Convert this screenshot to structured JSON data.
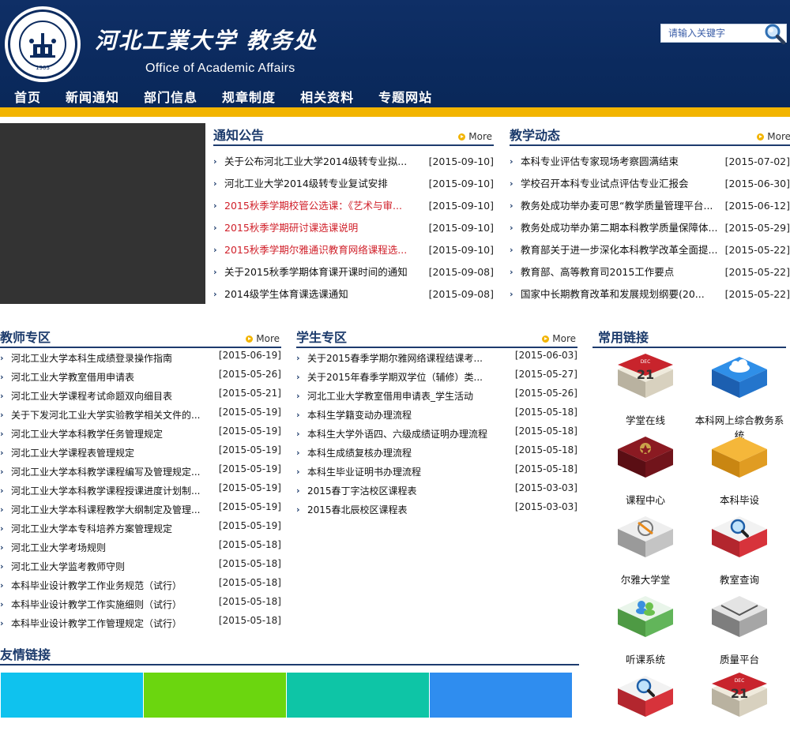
{
  "header": {
    "logo_year": "1903",
    "brand_cn": "河北工業大学 教务处",
    "brand_en": "Office of Academic Affairs",
    "search_placeholder": "请输入关键字"
  },
  "nav": [
    "首页",
    "新闻通知",
    "部门信息",
    "规章制度",
    "相关资料",
    "专题网站"
  ],
  "more_label": "More",
  "notices": {
    "title": "通知公告",
    "items": [
      {
        "text": "关于公布河北工业大学2014级转专业拟...",
        "date": "[2015-09-10]",
        "red": false
      },
      {
        "text": "河北工业大学2014级转专业复试安排",
        "date": "[2015-09-10]",
        "red": false
      },
      {
        "text": "2015秋季学期校管公选课：《艺术与审...",
        "date": "[2015-09-10]",
        "red": true
      },
      {
        "text": "2015秋季学期研讨课选课说明",
        "date": "[2015-09-10]",
        "red": true
      },
      {
        "text": "2015秋季学期尔雅通识教育网络课程选...",
        "date": "[2015-09-10]",
        "red": true
      },
      {
        "text": "关于2015秋季学期体育课开课时间的通知",
        "date": "[2015-09-08]",
        "red": false
      },
      {
        "text": "2014级学生体育课选课通知",
        "date": "[2015-09-08]",
        "red": false
      }
    ]
  },
  "teaching": {
    "title": "教学动态",
    "items": [
      {
        "text": "本科专业评估专家现场考察圆满结束",
        "date": "[2015-07-02]"
      },
      {
        "text": "学校召开本科专业试点评估专业汇报会",
        "date": "[2015-06-30]"
      },
      {
        "text": "教务处成功举办麦可思“教学质量管理平台...",
        "date": "[2015-06-12]"
      },
      {
        "text": "教务处成功举办第二期本科教学质量保障体...",
        "date": "[2015-05-29]"
      },
      {
        "text": "教育部关于进一步深化本科教学改革全面提...",
        "date": "[2015-05-22]"
      },
      {
        "text": "教育部、高等教育司2015工作要点",
        "date": "[2015-05-22]"
      },
      {
        "text": "国家中长期教育改革和发展规划纲要(20...",
        "date": "[2015-05-22]"
      }
    ]
  },
  "teachers": {
    "title": "教师专区",
    "items": [
      {
        "text": "河北工业大学本科生成绩登录操作指南",
        "date": "[2015-06-19]"
      },
      {
        "text": "河北工业大学教室借用申请表",
        "date": "[2015-05-26]"
      },
      {
        "text": "河北工业大学课程考试命题双向细目表",
        "date": "[2015-05-21]"
      },
      {
        "text": "关于下发河北工业大学实验教学相关文件的...",
        "date": "[2015-05-19]"
      },
      {
        "text": "河北工业大学本科教学任务管理规定",
        "date": "[2015-05-19]"
      },
      {
        "text": "河北工业大学课程表管理规定",
        "date": "[2015-05-19]"
      },
      {
        "text": "河北工业大学本科教学课程编写及管理规定...",
        "date": "[2015-05-19]"
      },
      {
        "text": "河北工业大学本科教学课程授课进度计划制...",
        "date": "[2015-05-19]"
      },
      {
        "text": "河北工业大学本科课程教学大纲制定及管理...",
        "date": "[2015-05-19]"
      },
      {
        "text": "河北工业大学本专科培养方案管理规定",
        "date": "[2015-05-19]"
      },
      {
        "text": "河北工业大学考场规则",
        "date": "[2015-05-18]"
      },
      {
        "text": "河北工业大学监考教师守则",
        "date": "[2015-05-18]"
      },
      {
        "text": "本科毕业设计教学工作业务规范（试行）",
        "date": "[2015-05-18]"
      },
      {
        "text": "本科毕业设计教学工作实施细则（试行）",
        "date": "[2015-05-18]"
      },
      {
        "text": "本科毕业设计教学工作管理规定（试行）",
        "date": "[2015-05-18]"
      }
    ]
  },
  "students": {
    "title": "学生专区",
    "items": [
      {
        "text": "关于2015春季学期尔雅网络课程结课考...",
        "date": "[2015-06-03]"
      },
      {
        "text": "关于2015年春季学期双学位（辅修）类...",
        "date": "[2015-05-27]"
      },
      {
        "text": "河北工业大学教室借用申请表_学生活动",
        "date": "[2015-05-26]"
      },
      {
        "text": "本科生学籍变动办理流程",
        "date": "[2015-05-18]"
      },
      {
        "text": "本科生大学外语四、六级成绩证明办理流程",
        "date": "[2015-05-18]"
      },
      {
        "text": "本科生成绩复核办理流程",
        "date": "[2015-05-18]"
      },
      {
        "text": "本科生毕业证明书办理流程",
        "date": "[2015-05-18]"
      },
      {
        "text": "2015春丁字沽校区课程表",
        "date": "[2015-03-03]"
      },
      {
        "text": "2015春北辰校区课程表",
        "date": "[2015-03-03]"
      }
    ]
  },
  "common_links": {
    "title": "常用链接",
    "items": [
      {
        "label": "学堂在线",
        "icon": "calendar-icon"
      },
      {
        "label": "本科网上综合教务系统",
        "icon": "cloud-icon"
      },
      {
        "label": "课程中心",
        "icon": "book-icon"
      },
      {
        "label": "本科毕设",
        "icon": "folder-icon"
      },
      {
        "label": "尔雅大学堂",
        "icon": "pencil-icon"
      },
      {
        "label": "教室查询",
        "icon": "search-icon"
      },
      {
        "label": "听课系统",
        "icon": "users-icon"
      },
      {
        "label": "质量平台",
        "icon": "mail-icon"
      },
      {
        "label": "",
        "icon": "search-icon"
      },
      {
        "label": "",
        "icon": "calendar-icon"
      }
    ],
    "calendar_month": "DEC",
    "calendar_day": "21"
  },
  "friend_links": {
    "title": "友情链接",
    "tile_colors": [
      "#0fc2ee",
      "#6bd60f",
      "#0ec5a6",
      "#2f8def"
    ]
  },
  "colors": {
    "navy": "#0b2a5e",
    "gold": "#f2b400",
    "notice_red": "#d0202a"
  }
}
